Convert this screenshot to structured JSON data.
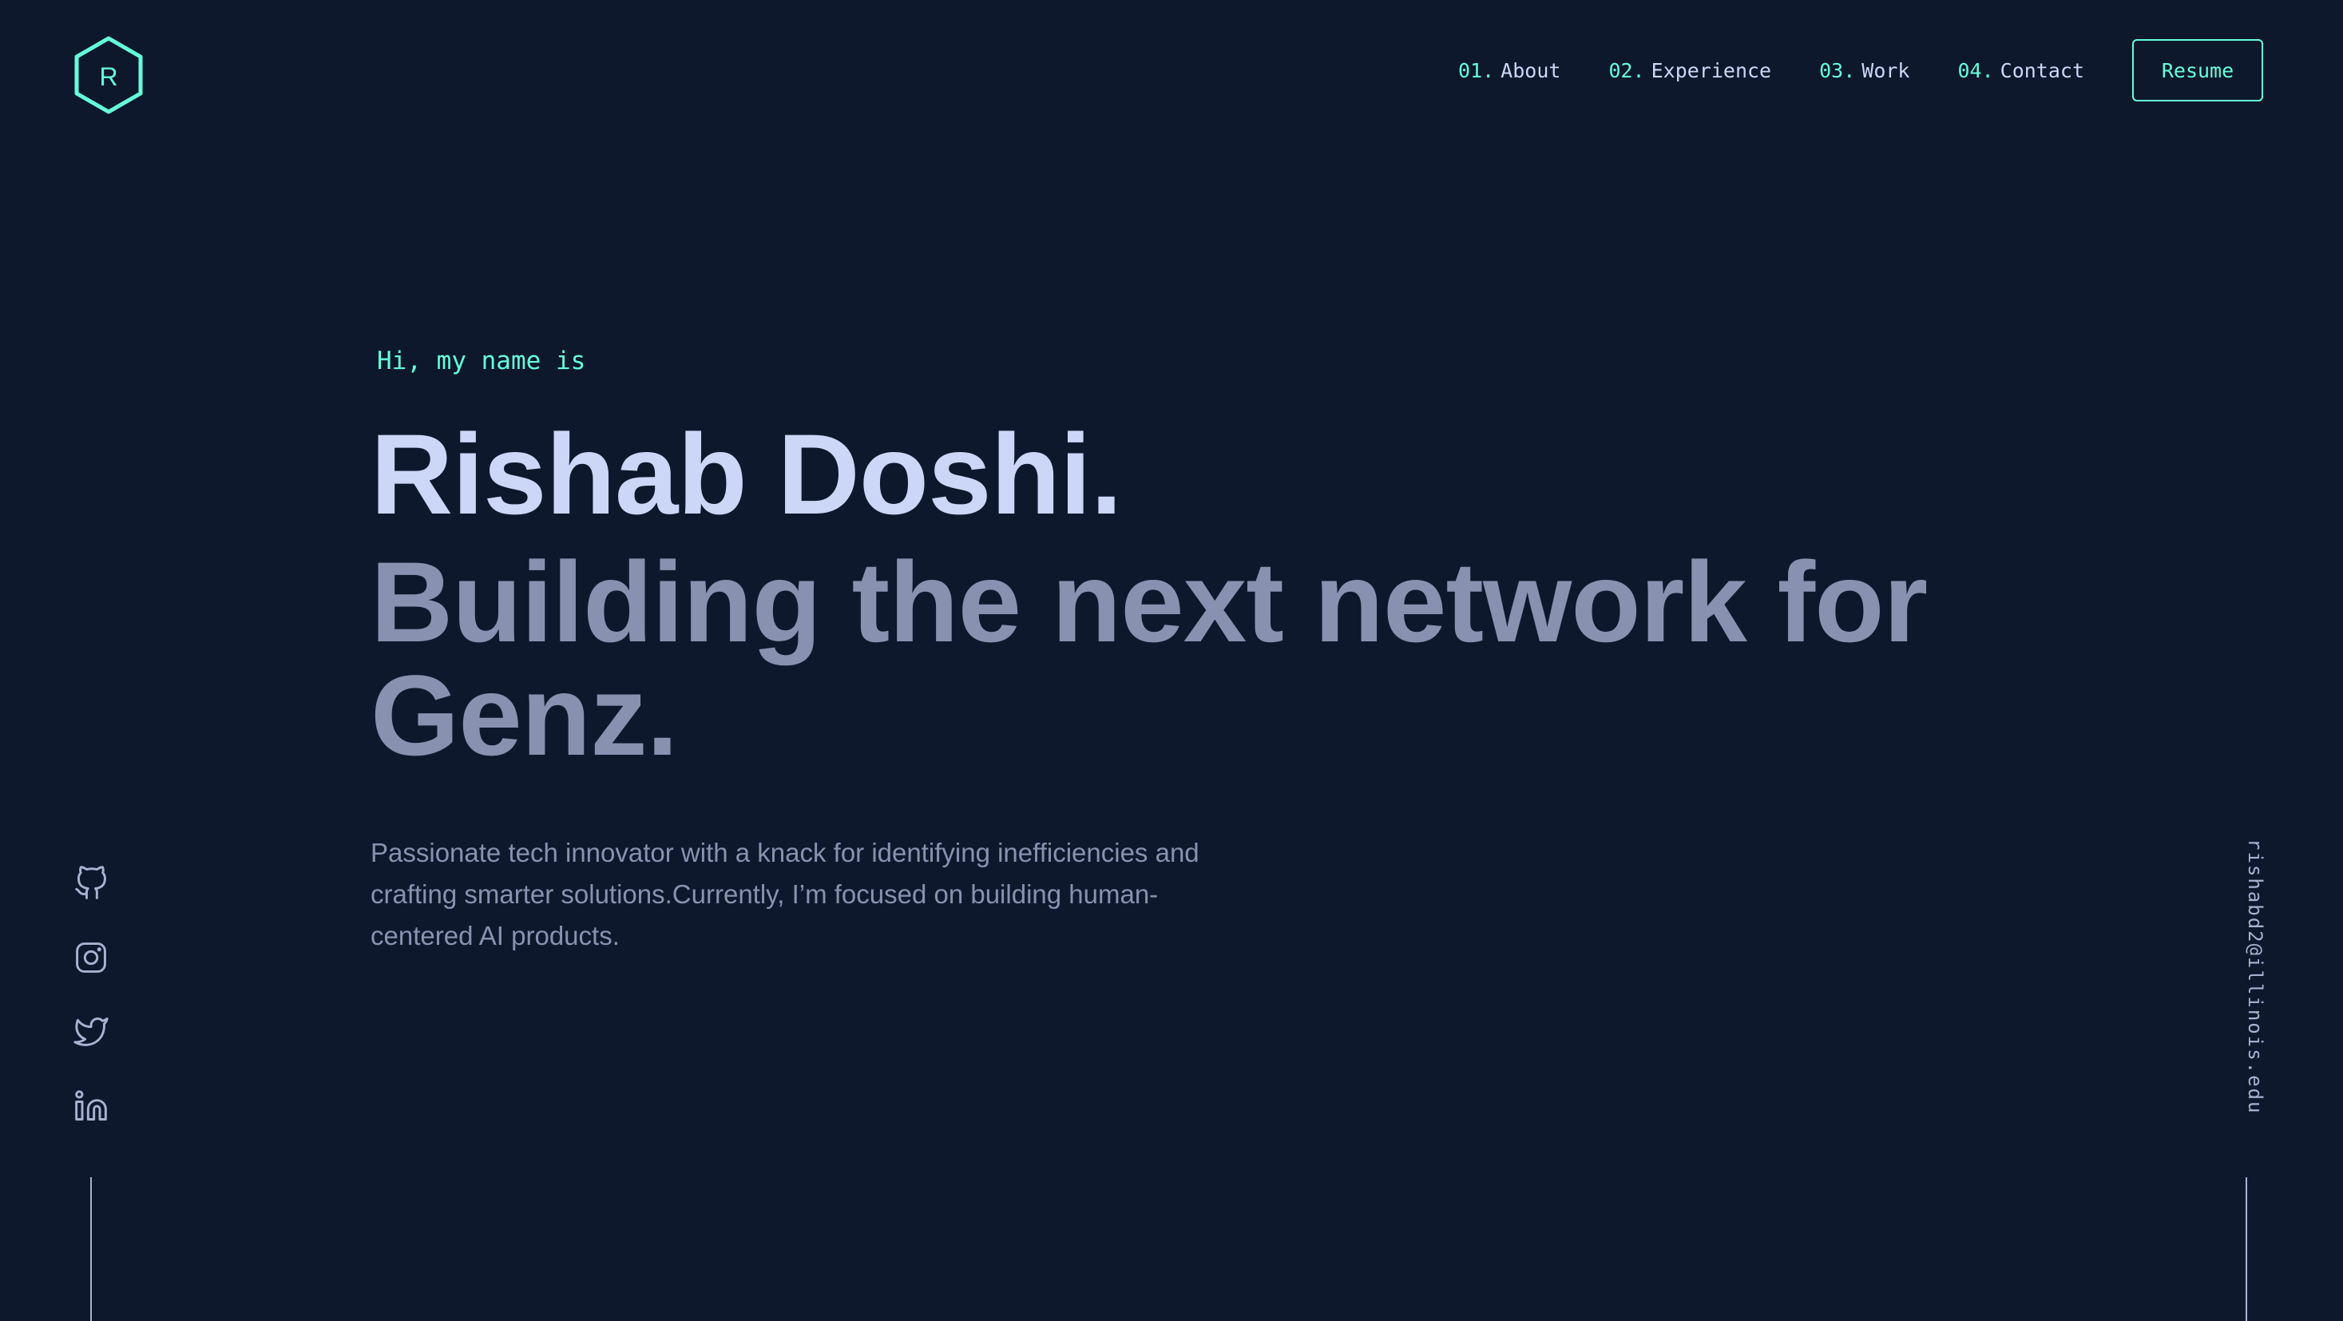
{
  "colors": {
    "background": "#0e182d",
    "accent": "#64ffda",
    "heading": "#ccd6f6",
    "body_text": "#8892b0",
    "muted": "#a8b2d1"
  },
  "header": {
    "logo_letter": "R",
    "logo_icon": "hexagon-logo-icon",
    "nav": [
      {
        "num": "01.",
        "label": "About"
      },
      {
        "num": "02.",
        "label": "Experience"
      },
      {
        "num": "03.",
        "label": "Work"
      },
      {
        "num": "04.",
        "label": "Contact"
      }
    ],
    "resume_label": "Resume"
  },
  "hero": {
    "greeting": "Hi, my name is",
    "name": "Rishab Doshi.",
    "tagline": "Building the next network for Genz.",
    "bio": "Passionate tech innovator with a knack for identifying inefficiencies and crafting smarter solutions.Currently, I’m focused on building human-centered AI products."
  },
  "social": {
    "icons": [
      "github-icon",
      "instagram-icon",
      "twitter-icon",
      "linkedin-icon"
    ]
  },
  "email": {
    "address": "rishabd2@illinois.edu"
  }
}
